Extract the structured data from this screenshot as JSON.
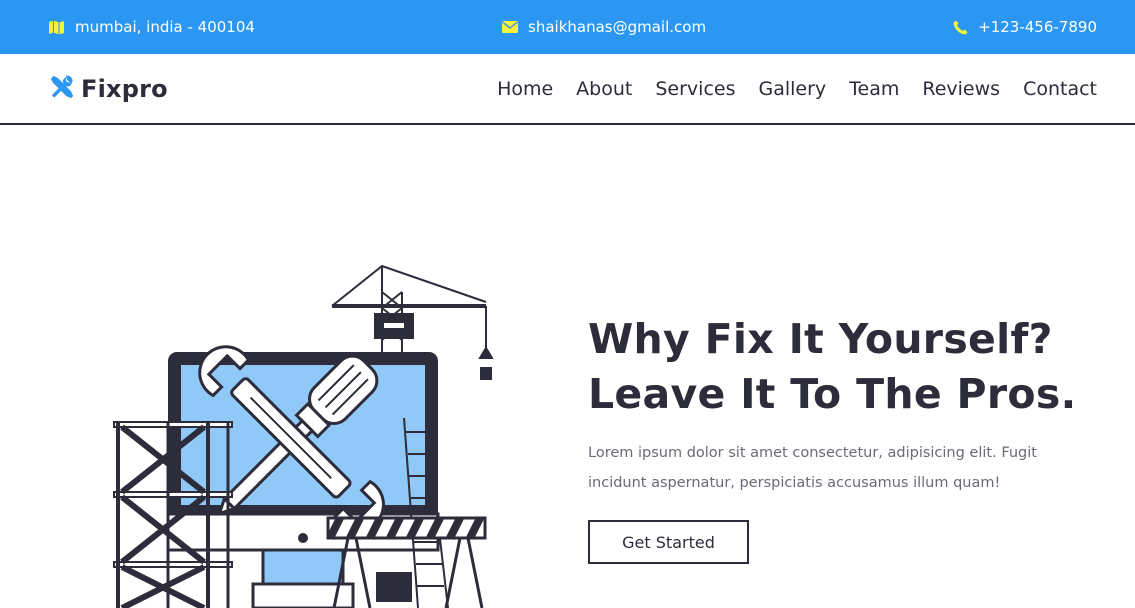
{
  "topbar": {
    "location": "mumbai, india - 400104",
    "email": "shaikhanas@gmail.com",
    "phone": "+123-456-7890",
    "icon_color": "#f5f23a",
    "background": "#2b97f2"
  },
  "header": {
    "logo_text": "Fixpro",
    "logo_icon": "tools-icon",
    "nav": [
      "Home",
      "About",
      "Services",
      "Gallery",
      "Team",
      "Reviews",
      "Contact"
    ]
  },
  "hero": {
    "title_line1": "Why Fix It Yourself?",
    "title_line2": "Leave It To The Pros.",
    "description": "Lorem ipsum dolor sit amet consectetur, adipisicing elit. Fugit incidunt aspernatur, perspiciatis accusamus illum quam!",
    "button_label": "Get Started",
    "illustration": "repair-computer-illustration",
    "accent_color": "#90c8f8"
  }
}
